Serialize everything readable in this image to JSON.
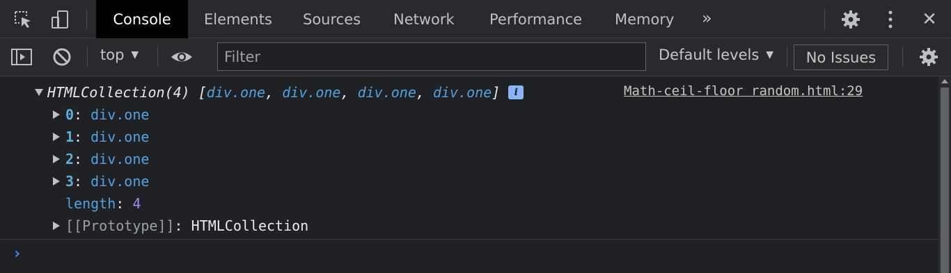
{
  "tabs": [
    {
      "label": "Console",
      "active": true
    },
    {
      "label": "Elements",
      "active": false
    },
    {
      "label": "Sources",
      "active": false
    },
    {
      "label": "Network",
      "active": false
    },
    {
      "label": "Performance",
      "active": false
    },
    {
      "label": "Memory",
      "active": false
    }
  ],
  "tabbar": {
    "overflow_glyph": "»",
    "close_glyph": "✕"
  },
  "toolbar": {
    "context": "top",
    "filter_placeholder": "Filter",
    "levels": "Default levels",
    "issues": "No Issues"
  },
  "console": {
    "header": {
      "name": "HTMLCollection(4)",
      "open_bracket": " [",
      "preview": [
        "div.one",
        "div.one",
        "div.one",
        "div.one"
      ],
      "close_bracket": "]",
      "info_badge": "i",
      "source": "Math-ceil-floor random.html:29"
    },
    "items": [
      {
        "key": "0",
        "value": "div.one"
      },
      {
        "key": "1",
        "value": "div.one"
      },
      {
        "key": "2",
        "value": "div.one"
      },
      {
        "key": "3",
        "value": "div.one"
      }
    ],
    "length": {
      "key": "length",
      "value": "4"
    },
    "prototype": {
      "key": "[[Prototype]]",
      "value": "HTMLCollection"
    },
    "prompt": "›"
  },
  "colors": {
    "accent": "#8ab4f8",
    "background": "#202124",
    "toolbar": "#292a2d"
  }
}
